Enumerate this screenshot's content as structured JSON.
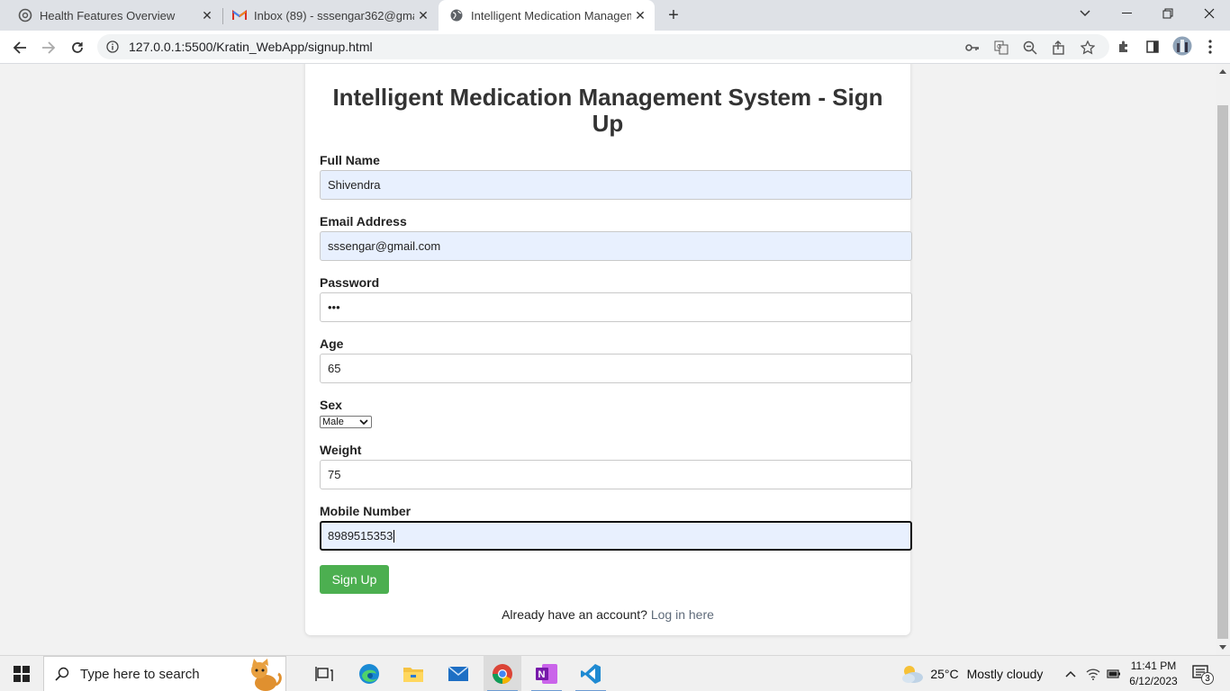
{
  "browser": {
    "tabs": [
      {
        "title": "Health Features Overview",
        "icon": "chatgpt-icon"
      },
      {
        "title": "Inbox (89) - sssengar362@gmail.",
        "icon": "gmail-icon"
      },
      {
        "title": "Intelligent Medication Managem",
        "icon": "globe-icon"
      }
    ],
    "url": "127.0.0.1:5500/Kratin_WebApp/signup.html"
  },
  "page": {
    "title": "Intelligent Medication Management System - Sign Up",
    "fields": {
      "full_name": {
        "label": "Full Name",
        "value": "Shivendra"
      },
      "email": {
        "label": "Email Address",
        "value": "sssengar@gmail.com"
      },
      "password": {
        "label": "Password",
        "value": "•••"
      },
      "age": {
        "label": "Age",
        "value": "65"
      },
      "sex": {
        "label": "Sex",
        "value": "Male"
      },
      "weight": {
        "label": "Weight",
        "value": "75"
      },
      "mobile": {
        "label": "Mobile Number",
        "value": "8989515353"
      }
    },
    "signup_button": "Sign Up",
    "login_prompt": "Already have an account?",
    "login_link": "Log in here"
  },
  "taskbar": {
    "search_placeholder": "Type here to search",
    "weather_temp": "25°C",
    "weather_desc": "Mostly cloudy",
    "time": "11:41 PM",
    "date": "6/12/2023",
    "notification_count": "3"
  },
  "colors": {
    "accent_green": "#4caf50",
    "autofill_bg": "#e8f0fe"
  }
}
